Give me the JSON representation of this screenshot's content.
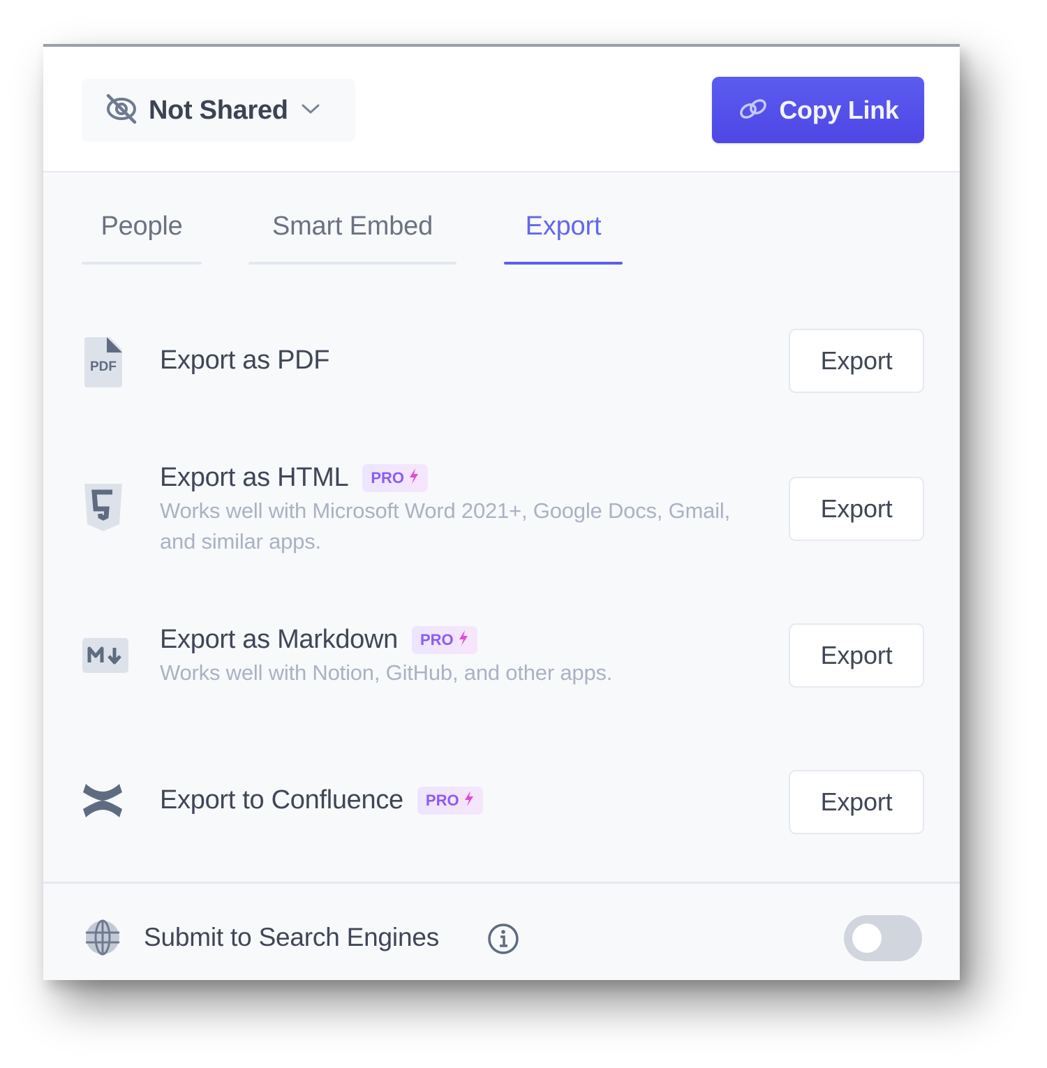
{
  "header": {
    "share_status": "Not Shared",
    "share_icon": "eye-off-icon",
    "copy_link_label": "Copy Link",
    "copy_link_icon": "link-icon"
  },
  "tabs": [
    {
      "label": "People",
      "active": false
    },
    {
      "label": "Smart Embed",
      "active": false
    },
    {
      "label": "Export",
      "active": true
    }
  ],
  "exports": [
    {
      "icon": "pdf-file-icon",
      "icon_text": "PDF",
      "title": "Export as PDF",
      "pro": false,
      "description": "",
      "button_label": "Export"
    },
    {
      "icon": "html5-icon",
      "icon_text": "5",
      "title": "Export as HTML",
      "pro": true,
      "description": "Works well with Microsoft Word 2021+, Google Docs, Gmail, and similar apps.",
      "button_label": "Export"
    },
    {
      "icon": "markdown-icon",
      "icon_text": "M↓",
      "title": "Export as Markdown",
      "pro": true,
      "description": "Works well with Notion, GitHub, and other apps.",
      "button_label": "Export"
    },
    {
      "icon": "confluence-icon",
      "icon_text": "",
      "title": "Export to Confluence",
      "pro": true,
      "description": "",
      "button_label": "Export"
    }
  ],
  "pro_badge": {
    "text": "PRO",
    "icon": "lightning-icon"
  },
  "footer": {
    "label": "Submit to Search Engines",
    "icon": "globe-icon",
    "info_icon": "info-icon",
    "toggle_on": false
  },
  "colors": {
    "accent": "#5b5ef0",
    "pro_text": "#8b5cf6",
    "pro_bolt": "#e04ad8",
    "icon_gray": "#5f6b80"
  }
}
